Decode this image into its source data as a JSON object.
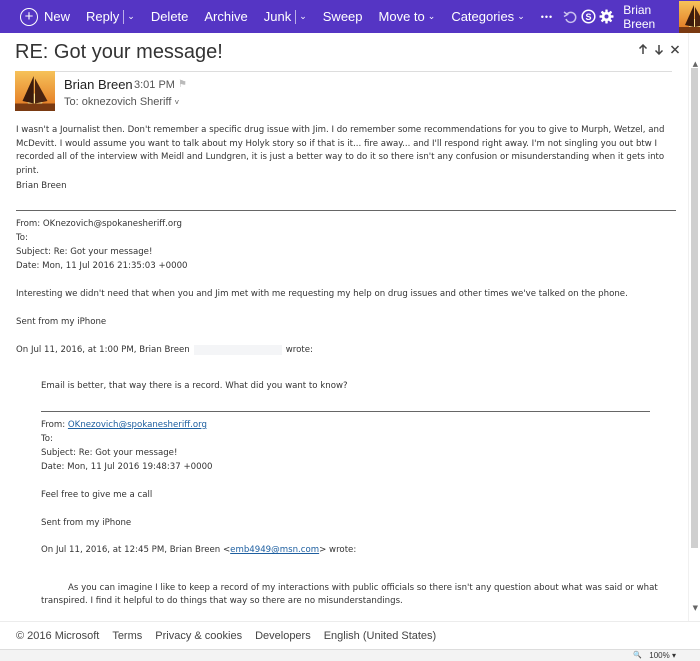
{
  "toolbar": {
    "new_label": "New",
    "reply_label": "Reply",
    "delete_label": "Delete",
    "archive_label": "Archive",
    "junk_label": "Junk",
    "sweep_label": "Sweep",
    "moveto_label": "Move to",
    "categories_label": "Categories",
    "more_label": "•••",
    "user_name": "Brian Breen",
    "accent": "#5535c4"
  },
  "message": {
    "subject": "RE: Got your message!",
    "sender": "Brian Breen",
    "time": "3:01 PM",
    "to_label": "To: oknezovich Sheriff"
  },
  "body": {
    "para1": "I wasn't a Journalist then. Don't remember a specific drug issue with Jim. I do remember some recommendations for you to give to Murph, Wetzel, and McDevitt. I would assume you want to talk about my Holyk story so if that is it... fire away... and I'll respond right away. I'm not singling you out btw I recorded all of the interview with Meidl and Lundgren, it is just a better way to do it so there isn't any confusion or misunderstanding when it gets into print.",
    "sig": "Brian Breen"
  },
  "reply1": {
    "from": "From: OKnezovich@spokanesheriff.org",
    "to": "To:",
    "subject": "Subject: Re: Got your message!",
    "date": "Date: Mon, 11 Jul 2016 21:35:03 +0000",
    "text": "Interesting we didn't need that when you and Jim met with me requesting my help on drug issues and other times we've talked on the phone.",
    "sent": "Sent from my iPhone",
    "onwrote_prefix": "On Jul 11, 2016, at 1:00 PM, Brian Breen",
    "onwrote_suffix": "wrote:"
  },
  "quote1": {
    "text": "Email is better, that way there is a record. What did you want to know?",
    "from_label": "From: ",
    "from_email": "OKnezovich@spokanesheriff.org",
    "to": "To:",
    "subject": "Subject: Re: Got your message!",
    "date": "Date: Mon, 11 Jul 2016 19:48:37 +0000",
    "text2": "Feel free to give me a call",
    "sent": "Sent from my iPhone",
    "onwrote_prefix": "On Jul 11, 2016, at 12:45 PM, Brian Breen <",
    "onwrote_email": "emb4949@msn.com",
    "onwrote_suffix": "> wrote:"
  },
  "quote2": {
    "line1": "As you can imagine I like to keep a record of my interactions with public officials so there isn't any question about what was said or what",
    "line2": "transpired. I find it helpful to do things that way so there are no misunderstandings."
  },
  "footer": {
    "copyright": "© 2016 Microsoft",
    "terms": "Terms",
    "privacy": "Privacy & cookies",
    "developers": "Developers",
    "language": "English (United States)"
  },
  "statusbar": {
    "zoom": "100%"
  }
}
